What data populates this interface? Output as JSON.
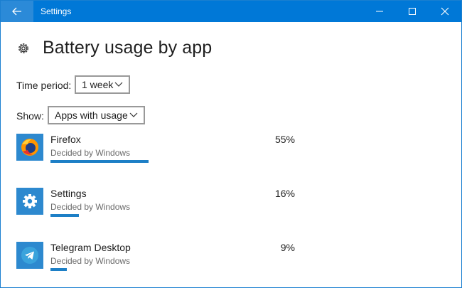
{
  "window": {
    "title": "Settings",
    "accent": "#0078d7",
    "controls": [
      "back-arrow-icon",
      "minimize-icon",
      "maximize-icon",
      "close-icon"
    ]
  },
  "page": {
    "title": "Battery usage by app",
    "icon": "gear-icon"
  },
  "filters": {
    "time_period_label": "Time period:",
    "time_period_value": "1 week",
    "show_label": "Show:",
    "show_value": "Apps with usage"
  },
  "apps": [
    {
      "name": "Firefox",
      "status": "Decided by Windows",
      "percent_label": "55%",
      "percent": 55,
      "icon": "firefox-icon"
    },
    {
      "name": "Settings",
      "status": "Decided by Windows",
      "percent_label": "16%",
      "percent": 16,
      "icon": "settings-gear-icon"
    },
    {
      "name": "Telegram Desktop",
      "status": "Decided by Windows",
      "percent_label": "9%",
      "percent": 9,
      "icon": "telegram-icon"
    }
  ]
}
